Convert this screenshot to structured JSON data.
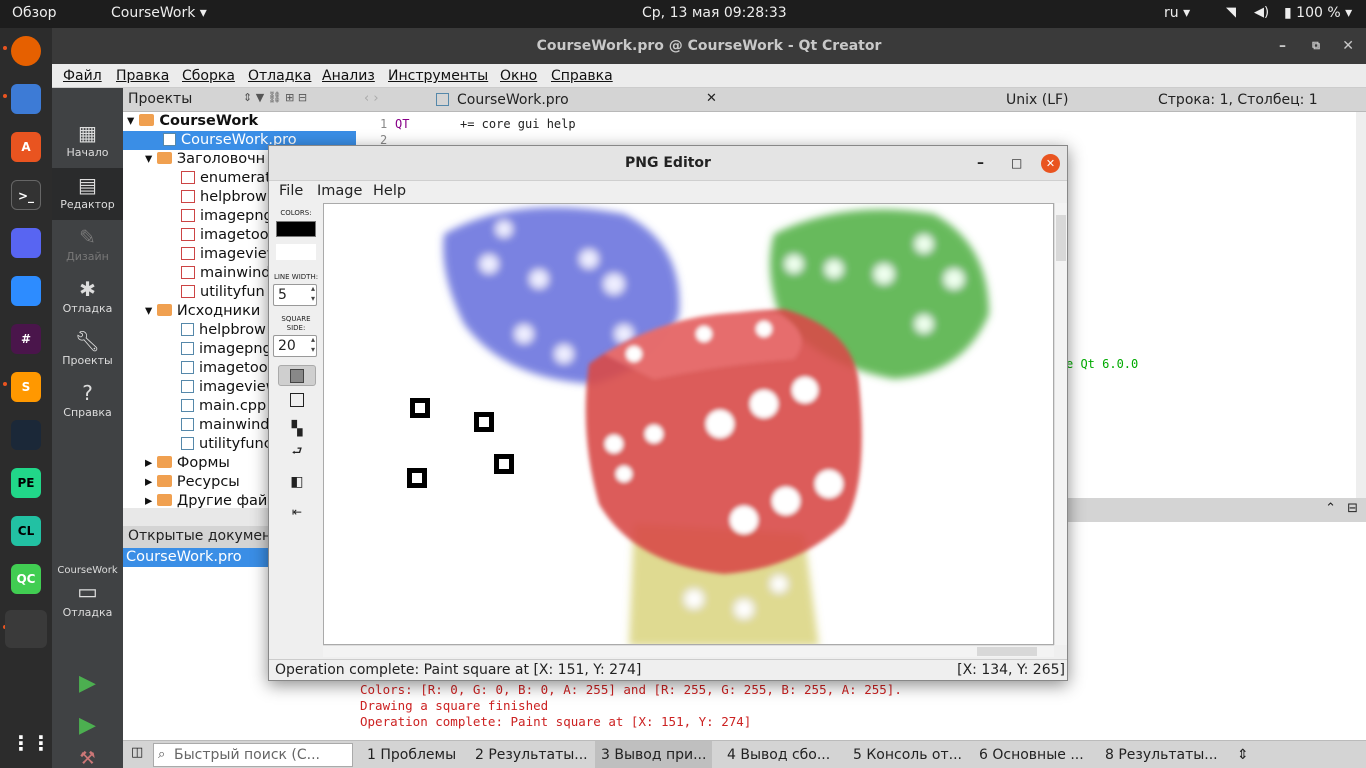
{
  "topbar": {
    "overview": "Обзор",
    "app": "CourseWork",
    "datetime": "Ср, 13 мая  09:28:33",
    "lang": "ru",
    "battery": "100 %"
  },
  "dock": {
    "icons": [
      "firefox-icon",
      "files-icon",
      "software-icon",
      "terminal-icon",
      "discord-icon",
      "zoom-icon",
      "slack-icon",
      "sublime-icon",
      "steam-icon",
      "pycharm-icon",
      "clion-icon",
      "qtcreator-icon",
      "apps-grid-icon"
    ],
    "labels": {
      "pe": "PE",
      "cl": "CL",
      "qc": "QC"
    }
  },
  "qt": {
    "title": "CourseWork.pro @ CourseWork - Qt Creator",
    "menu": [
      "Файл",
      "Правка",
      "Сборка",
      "Отладка",
      "Анализ",
      "Инструменты",
      "Окно",
      "Справка"
    ],
    "modes": [
      "Начало",
      "Редактор",
      "Дизайн",
      "Отладка",
      "Проекты",
      "Справка"
    ],
    "target": {
      "project": "CourseWork",
      "mode": "Отладка"
    },
    "projects_header": "Проекты",
    "tree": {
      "root": "CourseWork",
      "pro": "CourseWork.pro",
      "headers": "Заголовочн",
      "header_files": [
        "enumerat",
        "helpbrow",
        "imagepng",
        "imagetoo",
        "imageview",
        "mainwind",
        "utilityfun"
      ],
      "sources": "Исходники",
      "source_files": [
        "helpbrow",
        "imagepng",
        "imagetoo",
        "imageview",
        "main.cpp",
        "mainwind",
        "utilityfunc"
      ],
      "forms": "Формы",
      "resources": "Ресурсы",
      "other": "Другие фай"
    },
    "open_docs_header": "Открытые документ",
    "open_docs": [
      "CourseWork.pro"
    ],
    "editor_tab": "CourseWork.pro",
    "line_ending": "Unix (LF)",
    "cursor": "Строка: 1, Столбец: 1",
    "code": {
      "line1_num": "1",
      "line1_key": "QT",
      "line1_val": "+= core gui help",
      "line2_num": "2",
      "fragment": "e Qt 6.0.0"
    },
    "output": [
      "Colors: [R: 0, G: 0, B: 0, A: 255] and [R: 255, G: 255, B: 255, A: 255].",
      "Drawing a square finished",
      "Operation complete: Paint square at [X: 151, Y: 274]"
    ],
    "search_placeholder": "Быстрый поиск (С...",
    "panes": [
      "1  Проблемы",
      "2  Результаты...",
      "3  Вывод при...",
      "4  Вывод сбо...",
      "5  Консоль от...",
      "6  Основные ...",
      "8  Результаты..."
    ]
  },
  "png": {
    "title": "PNG Editor",
    "menu": [
      "File",
      "Image",
      "Help"
    ],
    "colors_label": "COLORS:",
    "primary_color": "#000000",
    "secondary_color": "#ffffff",
    "line_width_label": "LINE WIDTH:",
    "line_width": "5",
    "square_side_label": "SQUARE SIDE:",
    "square_side": "20",
    "status_left": "Operation complete: Paint square at [X: 151, Y: 274]",
    "status_right": "[X: 134, Y: 265]"
  }
}
